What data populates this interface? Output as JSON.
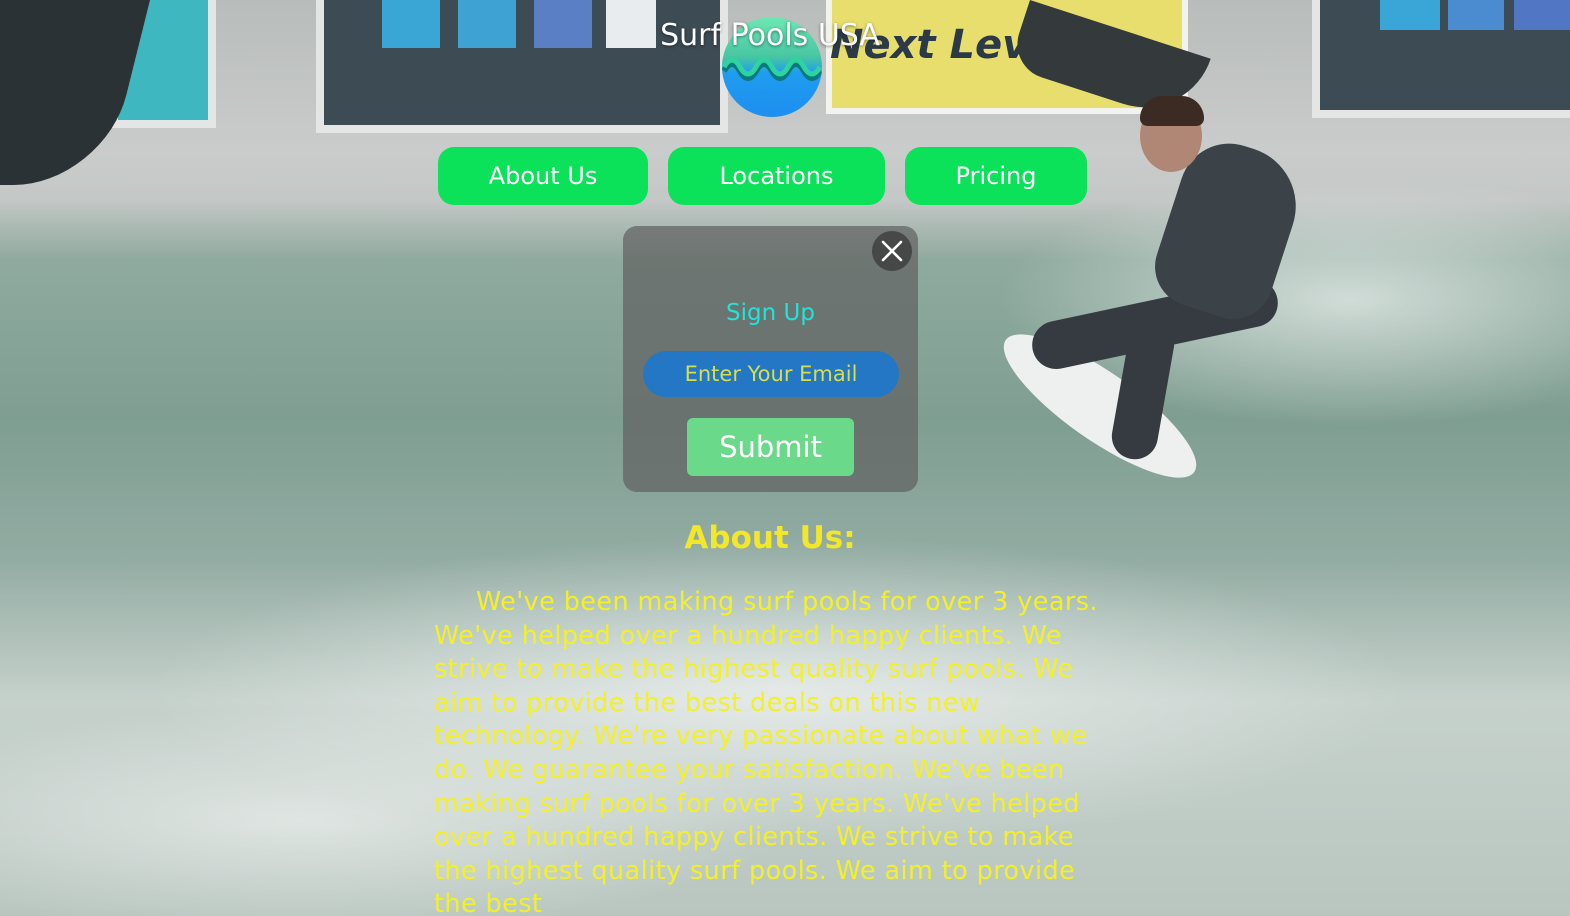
{
  "header": {
    "site_title": "Surf Pools USA",
    "logo_icon": "wave-logo-icon"
  },
  "nav": {
    "items": [
      {
        "label": "About Us"
      },
      {
        "label": "Locations"
      },
      {
        "label": "Pricing"
      }
    ]
  },
  "background": {
    "banner_text": "Next Level."
  },
  "signup": {
    "title": "Sign Up",
    "email_placeholder": "Enter Your Email",
    "submit_label": "Submit",
    "close_icon": "close-icon"
  },
  "about": {
    "heading": "About Us:",
    "body": "We've been making surf pools for over 3 years. We've helped over a hundred happy clients. We strive to make the highest quality surf pools. We aim to provide the best deals on this new technology. We're very passionate about what we do. We guarantee your satisfaction. We've been making surf pools for over 3 years. We've helped over a hundred happy clients. We strive to make the highest quality surf pools. We aim to provide the best"
  },
  "colors": {
    "nav_button": "#0be25a",
    "signup_title": "#22e3d8",
    "email_input_bg": "#2477c4",
    "email_placeholder": "#d7de4d",
    "submit_button": "#6bd98a",
    "about_text": "#f3f02a"
  }
}
